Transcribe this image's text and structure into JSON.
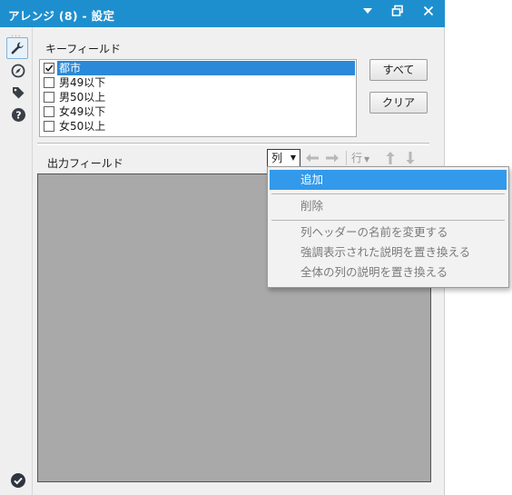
{
  "window": {
    "title": "アレンジ (8) - 設定",
    "title_buttons": [
      "menu-caret-icon",
      "restore-icon",
      "close-icon"
    ],
    "accent_color": "#1e8fce"
  },
  "sidebar": {
    "dots": "...",
    "icons": [
      "wrench-icon",
      "compass-icon",
      "tag-icon",
      "help-icon"
    ],
    "status_icon": "check-circle-icon"
  },
  "key_fields": {
    "label": "キーフィールド",
    "items": [
      {
        "label": "都市",
        "checked": true,
        "selected": true
      },
      {
        "label": "男49以下",
        "checked": false,
        "selected": false
      },
      {
        "label": "男50以上",
        "checked": false,
        "selected": false
      },
      {
        "label": "女49以下",
        "checked": false,
        "selected": false
      },
      {
        "label": "女50以上",
        "checked": false,
        "selected": false
      }
    ],
    "select_all_label": "すべて",
    "clear_label": "クリア"
  },
  "output_fields": {
    "label": "出力フィールド",
    "column_button": "列",
    "row_button": "行",
    "tool_icons": [
      "arrow-left-icon",
      "arrow-right-icon",
      "arrow-up-icon",
      "arrow-down-icon"
    ]
  },
  "column_menu": {
    "items": [
      {
        "label": "追加",
        "highlighted": true,
        "enabled": true
      },
      {
        "label": "削除",
        "enabled": false
      },
      {
        "label": "列ヘッダーの名前を変更する",
        "enabled": false
      },
      {
        "label": "強調表示された説明を置き換える",
        "enabled": false
      },
      {
        "label": "全体の列の説明を置き換える",
        "enabled": false
      }
    ],
    "highlight_color": "#3399ea"
  }
}
